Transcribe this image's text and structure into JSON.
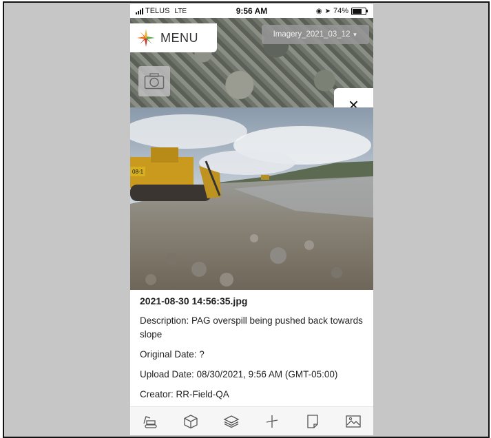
{
  "status_bar": {
    "carrier": "TELUS",
    "network": "LTE",
    "time": "9:56 AM",
    "battery": "74%",
    "battery_level": 0.74
  },
  "map": {
    "menu_label": "MENU",
    "imagery_select_value": "Imagery_2021_03_12",
    "close_label": "×"
  },
  "photo_info": {
    "filename": "2021-08-30 14:56:35.jpg",
    "description": "Description: PAG overspill being pushed back towards slope",
    "original_date": "Original Date: ?",
    "upload_date": "Upload Date: 08/30/2021, 9:56 AM (GMT-05:00)",
    "creator": "Creator: RR-Field-QA",
    "equipment_tag": "08-1"
  },
  "toolbar": {
    "items": [
      "excavator-tool-icon",
      "cube-icon",
      "layers-icon",
      "measure-icon",
      "document-icon",
      "image-icon"
    ]
  },
  "colors": {
    "frame_bg": "#c6c6c6",
    "logo_orange": "#e8782a",
    "logo_green": "#6aa84f",
    "logo_yellow": "#f2b134",
    "logo_red": "#cc3b2b"
  }
}
